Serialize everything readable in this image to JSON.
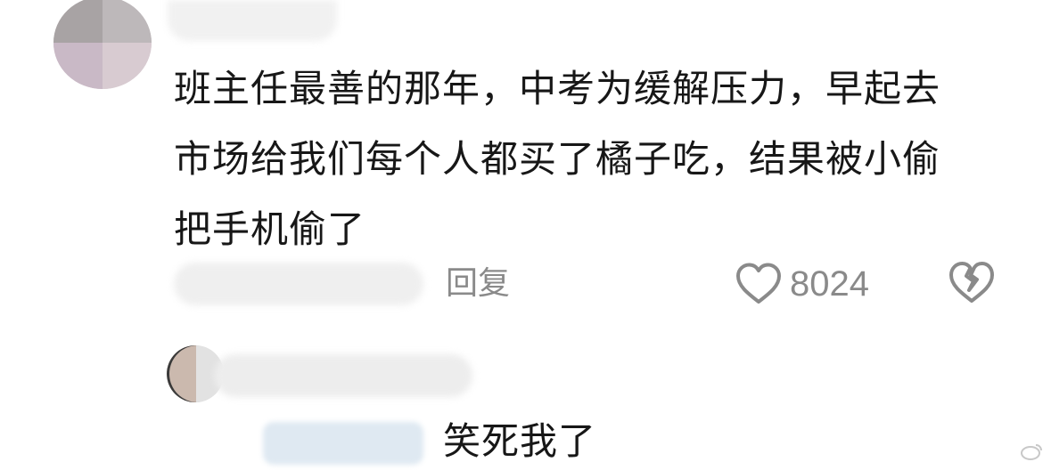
{
  "comment": {
    "text": "班主任最善的那年，中考为缓解压力，早起去市场给我们每个人都买了橘子吃，结果被小偷把手机偷了",
    "reply_label": "回复",
    "like_count": "8024",
    "like_icon": "heart-outline-icon",
    "dislike_icon": "broken-heart-icon"
  },
  "reply": {
    "text": "笑死我了"
  },
  "colors": {
    "text": "#171717",
    "meta": "#8a8a8a",
    "background": "#ffffff",
    "mention_blur": "#dfe9f2"
  }
}
